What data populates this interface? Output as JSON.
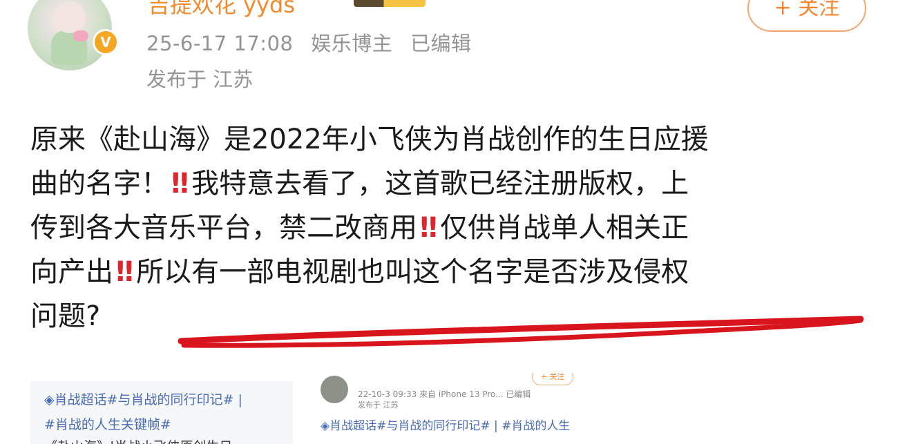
{
  "header": {
    "username": "吉提欢花 yyds",
    "timestamp": "25-6-17 17:08",
    "user_role": "娱乐博主",
    "edited_label": "已编辑",
    "location": "发布于 江苏",
    "follow_label": "+ 关注",
    "verified_mark": "V"
  },
  "post": {
    "lines": [
      "原来《赴山海》是2022年小飞侠为肖战创作的生日应援",
      "曲的名字！",
      "我特意去看了，这首歌已经注册版权，上",
      "传到各大音乐平台，禁二改商用",
      "仅供肖战单人相关正",
      "向产出",
      "所以有一部电视剧也叫这个名字是否涉及侵权",
      "问题?"
    ],
    "exclamation": "‼"
  },
  "embedded_left": {
    "tag_line": "◈肖战超话#与肖战的同行印记# |",
    "tag_line_2": "#肖战的人生关键帧#",
    "body_line": "《赴山海》|肖战小飞侠原创生日"
  },
  "embedded_right": {
    "meta": "22-10-3 09:33  来自 iPhone 13 Pro...  已编辑",
    "location": "发布于 江苏",
    "follow_label": "+ 关注",
    "tags": "◈肖战超话#与肖战的同行印记# | #肖战的人生"
  },
  "colors": {
    "username": "#f38a2b",
    "meta_gray": "#939393",
    "body_text": "#1a1a1a",
    "exclamation_red": "#e0262d",
    "underline_red": "#d8141c",
    "follow_orange": "#f5852f",
    "link_blue": "#4a6bb5"
  }
}
